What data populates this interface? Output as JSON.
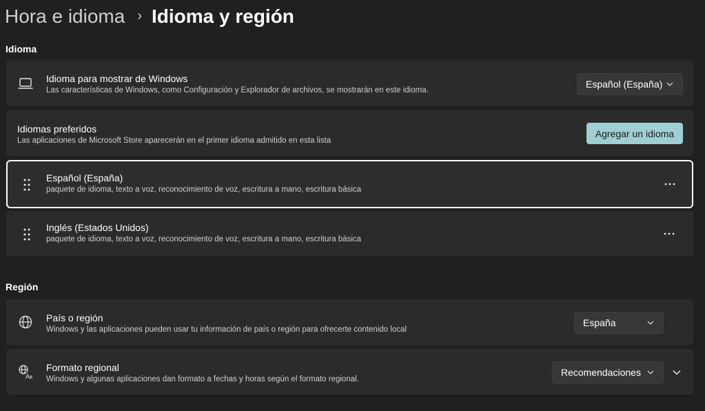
{
  "breadcrumb": {
    "parent": "Hora e idioma",
    "separator": "›",
    "current": "Idioma y región"
  },
  "sections": {
    "language": "Idioma",
    "region": "Región"
  },
  "display_language": {
    "title": "Idioma para mostrar de Windows",
    "description": "Las características de Windows, como Configuración y Explorador de archivos, se mostrarán en este idioma.",
    "value": "Español (España)",
    "icon": "laptop-icon"
  },
  "preferred_languages": {
    "title": "Idiomas preferidos",
    "description": "Las aplicaciones de Microsoft Store aparecerán en el primer idioma admitido en esta lista",
    "add_button": "Agregar un idioma",
    "items": [
      {
        "name": "Español (España)",
        "features": "paquete de idioma, texto a voz, reconocimiento de voz, escritura a mano, escritura básica"
      },
      {
        "name": "Inglés (Estados Unidos)",
        "features": "paquete de idioma, texto a voz, reconocimiento de voz, escritura a mano, escritura básica"
      }
    ]
  },
  "country_region": {
    "title": "País o región",
    "description": "Windows y las aplicaciones pueden usar tu información de país o región para ofrecerte contenido local",
    "value": "España",
    "icon": "globe-icon"
  },
  "regional_format": {
    "title": "Formato regional",
    "description": "Windows y algunas aplicaciones dan formato a fechas y horas según el formato regional.",
    "value": "Recomendaciones",
    "icon": "language-format-icon"
  },
  "colors": {
    "background": "#202020",
    "card": "#2b2b2b",
    "accent": "#9fcfd2"
  }
}
